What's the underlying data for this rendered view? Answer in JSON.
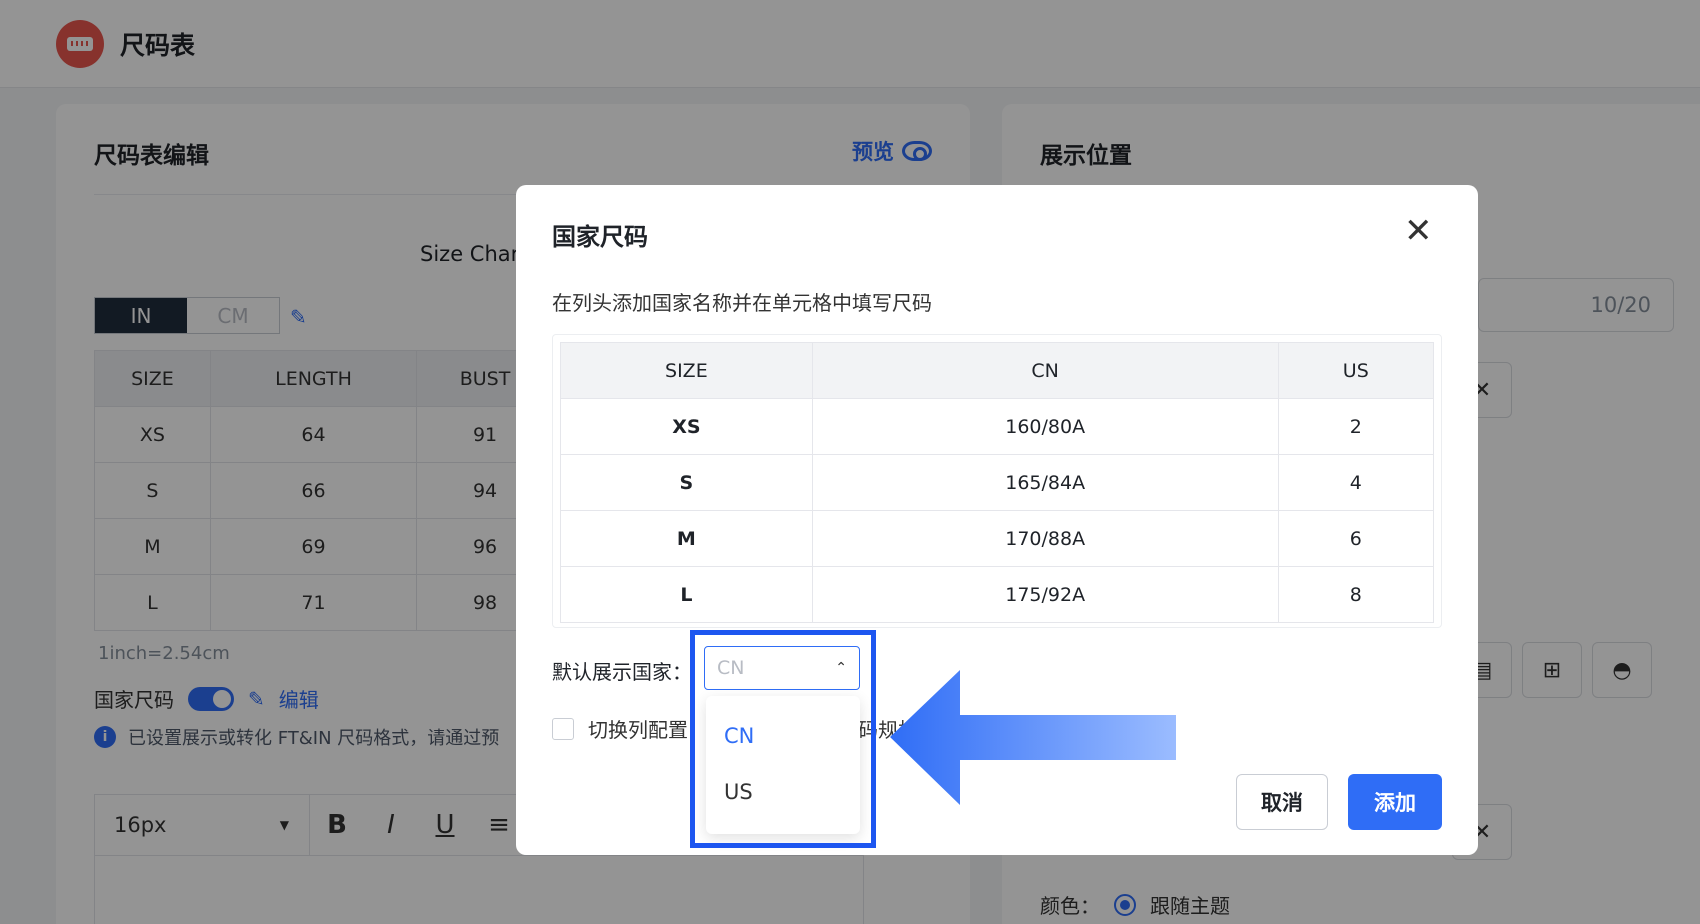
{
  "app": {
    "title": "尺码表"
  },
  "editor_card": {
    "title": "尺码表编辑",
    "preview_label": "预览",
    "chart_title": "Size Char",
    "unit_in": "IN",
    "unit_cm": "CM",
    "table": {
      "headers": [
        "SIZE",
        "LENGTH",
        "BUST"
      ],
      "rows": [
        [
          "XS",
          "64",
          "91"
        ],
        [
          "S",
          "66",
          "94"
        ],
        [
          "M",
          "69",
          "96"
        ],
        [
          "L",
          "71",
          "98"
        ]
      ]
    },
    "note": "1inch=2.54cm",
    "country_size_label": "国家尺码",
    "edit_label": "编辑",
    "info_text": "已设置展示或转化 FT&IN 尺码格式，请通过预",
    "font_size": "16px"
  },
  "position_card": {
    "title": "展示位置",
    "counter": "10/20",
    "color_label": "颜色：",
    "color_option": "跟随主题"
  },
  "modal": {
    "title": "国家尺码",
    "description": "在列头添加国家名称并在单元格中填写尺码",
    "table": {
      "headers": [
        "SIZE",
        "CN",
        "US"
      ],
      "rows": [
        [
          "XS",
          "160/80A",
          "2"
        ],
        [
          "S",
          "165/84A",
          "4"
        ],
        [
          "M",
          "170/88A",
          "6"
        ],
        [
          "L",
          "175/92A",
          "8"
        ]
      ]
    },
    "default_country_label": "默认展示国家：",
    "select_placeholder": "CN",
    "dropdown_options": [
      "CN",
      "US"
    ],
    "selected_option": "CN",
    "checkbox_label": "切换列配置",
    "checkbox_label_tail": "码规格",
    "cancel_label": "取消",
    "add_label": "添加"
  },
  "colors": {
    "accent": "#2f6df6",
    "highlight": "#1d56f0"
  }
}
